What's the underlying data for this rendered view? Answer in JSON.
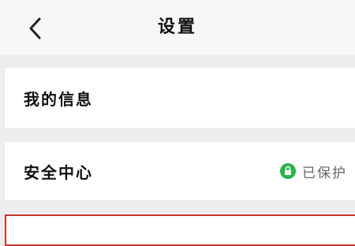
{
  "header": {
    "title": "设置",
    "back_icon": "chevron-left-icon"
  },
  "rows": [
    {
      "label": "我的信息"
    },
    {
      "label": "安全中心",
      "status": "已保护",
      "status_icon": "lock-icon",
      "status_color": "#2bb24c"
    },
    {
      "label": ""
    }
  ],
  "colors": {
    "background": "#ededed",
    "accent_green": "#2bb24c",
    "highlight_border": "#c8342f"
  }
}
